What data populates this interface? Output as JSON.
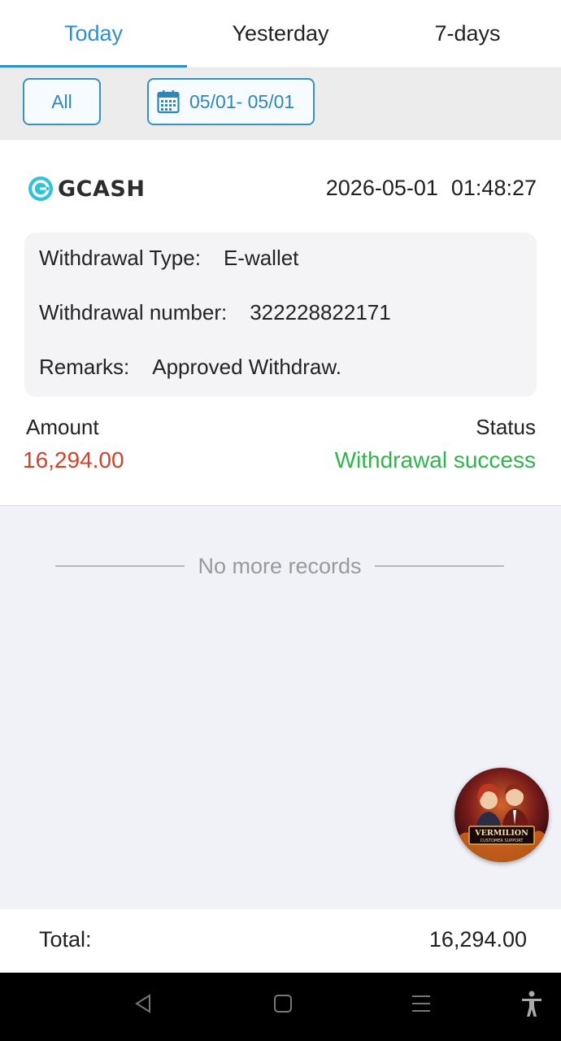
{
  "tabs": [
    {
      "label": "Today",
      "active": true
    },
    {
      "label": "Yesterday",
      "active": false
    },
    {
      "label": "7-days",
      "active": false
    }
  ],
  "filters": {
    "all_label": "All",
    "date_range": "05/01- 05/01",
    "date_icon": "calendar-icon"
  },
  "record": {
    "provider": "GCASH",
    "provider_icon": "gcash-logo",
    "date": "2026-05-01",
    "time": "01:48:27",
    "withdrawal_type_label": "Withdrawal Type:",
    "withdrawal_type_value": "E-wallet",
    "withdrawal_number_label": "Withdrawal number:",
    "withdrawal_number_value": "322228822171",
    "remarks_label": "Remarks:",
    "remarks_value": "Approved Withdraw.",
    "amount_label": "Amount",
    "amount_value": "16,294.00",
    "status_label": "Status",
    "status_value": "Withdrawal success"
  },
  "list_end_text": "No more records",
  "support_fab": {
    "icon": "customer-support-avatar",
    "badge_text": "VERMILION",
    "badge_subtext": "CUSTOMER SUPPORT"
  },
  "total": {
    "label": "Total:",
    "value": "16,294.00"
  },
  "colors": {
    "accent": "#2f8fc7",
    "amount": "#d0432b",
    "success": "#2db54b",
    "gcash": "#2fc3d8"
  },
  "system_nav": [
    "back-icon",
    "home-icon",
    "recents-icon",
    "accessibility-icon"
  ]
}
